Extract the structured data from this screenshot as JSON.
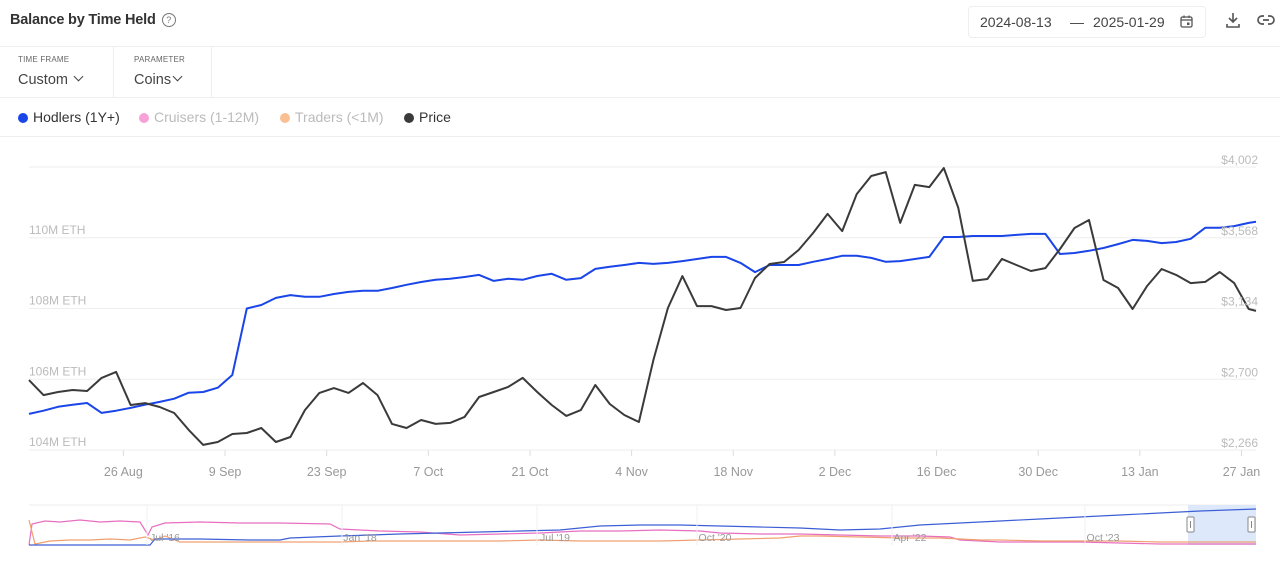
{
  "header": {
    "title": "Balance by Time Held",
    "help_icon": "question-circle-icon",
    "date_from": "2024-08-13",
    "date_sep": "—",
    "date_to": "2025-01-29",
    "calendar_icon": "calendar-icon",
    "download_icon": "download-icon",
    "link_icon": "link-icon"
  },
  "filters": [
    {
      "label": "TIME FRAME",
      "value": "Custom"
    },
    {
      "label": "PARAMETER",
      "value": "Coins"
    }
  ],
  "legend": [
    {
      "label": "Hodlers (1Y+)",
      "color": "#1a45e8",
      "active": true
    },
    {
      "label": "Cruisers (1-12M)",
      "color": "#f7a1d6",
      "active": false
    },
    {
      "label": "Traders (<1M)",
      "color": "#fbbf94",
      "active": false
    },
    {
      "label": "Price",
      "color": "#3a3a3a",
      "active": true
    }
  ],
  "chart_data": {
    "type": "line",
    "title": "Balance by Time Held",
    "x_ticks": [
      "26 Aug",
      "9 Sep",
      "23 Sep",
      "7 Oct",
      "21 Oct",
      "4 Nov",
      "18 Nov",
      "2 Dec",
      "16 Dec",
      "30 Dec",
      "13 Jan",
      "27 Jan"
    ],
    "x_tick_dates": [
      "2024-08-26",
      "2024-09-09",
      "2024-09-23",
      "2024-10-07",
      "2024-10-21",
      "2024-11-04",
      "2024-11-18",
      "2024-12-02",
      "2024-12-16",
      "2024-12-30",
      "2025-01-13",
      "2025-01-27"
    ],
    "xlim": [
      "2024-08-13",
      "2025-01-29"
    ],
    "left_axis": {
      "ticks": [
        "104M ETH",
        "106M ETH",
        "108M ETH",
        "110M ETH"
      ],
      "tick_values": [
        104,
        106,
        108,
        110
      ],
      "ylim": [
        104,
        112
      ],
      "unit": "M ETH"
    },
    "right_axis": {
      "ticks": [
        "$2,266",
        "$2,700",
        "$3,134",
        "$3,568",
        "$4,002"
      ],
      "tick_values": [
        2266,
        2700,
        3134,
        3568,
        4002
      ],
      "ylim": [
        2266,
        4002
      ]
    },
    "grid": true,
    "legend_position": "top-left",
    "dates": [
      "2024-08-13",
      "2024-08-15",
      "2024-08-17",
      "2024-08-19",
      "2024-08-21",
      "2024-08-23",
      "2024-08-25",
      "2024-08-27",
      "2024-08-29",
      "2024-08-31",
      "2024-09-02",
      "2024-09-04",
      "2024-09-06",
      "2024-09-08",
      "2024-09-10",
      "2024-09-12",
      "2024-09-14",
      "2024-09-16",
      "2024-09-18",
      "2024-09-20",
      "2024-09-22",
      "2024-09-24",
      "2024-09-26",
      "2024-09-28",
      "2024-09-30",
      "2024-10-02",
      "2024-10-04",
      "2024-10-06",
      "2024-10-08",
      "2024-10-10",
      "2024-10-12",
      "2024-10-14",
      "2024-10-16",
      "2024-10-18",
      "2024-10-20",
      "2024-10-22",
      "2024-10-24",
      "2024-10-26",
      "2024-10-28",
      "2024-10-30",
      "2024-11-01",
      "2024-11-03",
      "2024-11-05",
      "2024-11-07",
      "2024-11-09",
      "2024-11-11",
      "2024-11-13",
      "2024-11-15",
      "2024-11-17",
      "2024-11-19",
      "2024-11-21",
      "2024-11-23",
      "2024-11-25",
      "2024-11-27",
      "2024-11-29",
      "2024-12-01",
      "2024-12-03",
      "2024-12-05",
      "2024-12-07",
      "2024-12-09",
      "2024-12-11",
      "2024-12-13",
      "2024-12-15",
      "2024-12-17",
      "2024-12-19",
      "2024-12-21",
      "2024-12-23",
      "2024-12-25",
      "2024-12-27",
      "2024-12-29",
      "2024-12-31",
      "2025-01-02",
      "2025-01-04",
      "2025-01-06",
      "2025-01-08",
      "2025-01-10",
      "2025-01-12",
      "2025-01-14",
      "2025-01-16",
      "2025-01-18",
      "2025-01-20",
      "2025-01-22",
      "2025-01-24",
      "2025-01-26",
      "2025-01-28",
      "2025-01-29"
    ],
    "series": [
      {
        "name": "Hodlers (1Y+)",
        "axis": "left",
        "color": "#1a45e8",
        "values": [
          105.02,
          105.11,
          105.22,
          105.28,
          105.33,
          105.05,
          105.11,
          105.19,
          105.28,
          105.36,
          105.45,
          105.62,
          105.64,
          105.76,
          106.12,
          108.0,
          108.1,
          108.3,
          108.38,
          108.33,
          108.33,
          108.41,
          108.47,
          108.5,
          108.5,
          108.58,
          108.67,
          108.75,
          108.81,
          108.84,
          108.89,
          108.95,
          108.78,
          108.84,
          108.81,
          108.92,
          108.98,
          108.81,
          108.86,
          109.12,
          109.18,
          109.23,
          109.29,
          109.26,
          109.29,
          109.34,
          109.4,
          109.46,
          109.46,
          109.29,
          109.03,
          109.23,
          109.23,
          109.23,
          109.32,
          109.4,
          109.49,
          109.49,
          109.43,
          109.32,
          109.34,
          109.4,
          109.46,
          110.02,
          110.02,
          110.05,
          110.05,
          110.05,
          110.08,
          110.11,
          110.11,
          109.54,
          109.57,
          109.63,
          109.71,
          109.82,
          109.94,
          109.91,
          109.85,
          109.88,
          109.97,
          110.28,
          110.28,
          110.33,
          110.42,
          110.45
        ]
      },
      {
        "name": "Price",
        "axis": "right",
        "color": "#3a3a3a",
        "values": [
          2695,
          2603,
          2622,
          2634,
          2628,
          2708,
          2745,
          2542,
          2554,
          2530,
          2493,
          2389,
          2297,
          2315,
          2364,
          2370,
          2401,
          2315,
          2346,
          2511,
          2616,
          2646,
          2616,
          2677,
          2603,
          2426,
          2401,
          2450,
          2426,
          2432,
          2469,
          2591,
          2622,
          2653,
          2708,
          2622,
          2542,
          2475,
          2511,
          2665,
          2548,
          2481,
          2438,
          2818,
          3137,
          3333,
          3149,
          3149,
          3125,
          3137,
          3321,
          3407,
          3419,
          3493,
          3597,
          3714,
          3609,
          3836,
          3947,
          3971,
          3659,
          3892,
          3879,
          3996,
          3751,
          3303,
          3315,
          3438,
          3401,
          3364,
          3382,
          3499,
          3628,
          3677,
          3309,
          3260,
          3131,
          3272,
          3376,
          3340,
          3290,
          3297,
          3358,
          3290,
          3131,
          3119
        ]
      }
    ],
    "navigator": {
      "ticks": [
        "Jul '16",
        "Jan '18",
        "Jul '19",
        "Oct '20",
        "Apr '22",
        "Oct '23"
      ],
      "series_colors": {
        "hodlers": "#3d5fd6",
        "cruisers": "#e86fc0",
        "traders": "#f0a070"
      }
    }
  }
}
